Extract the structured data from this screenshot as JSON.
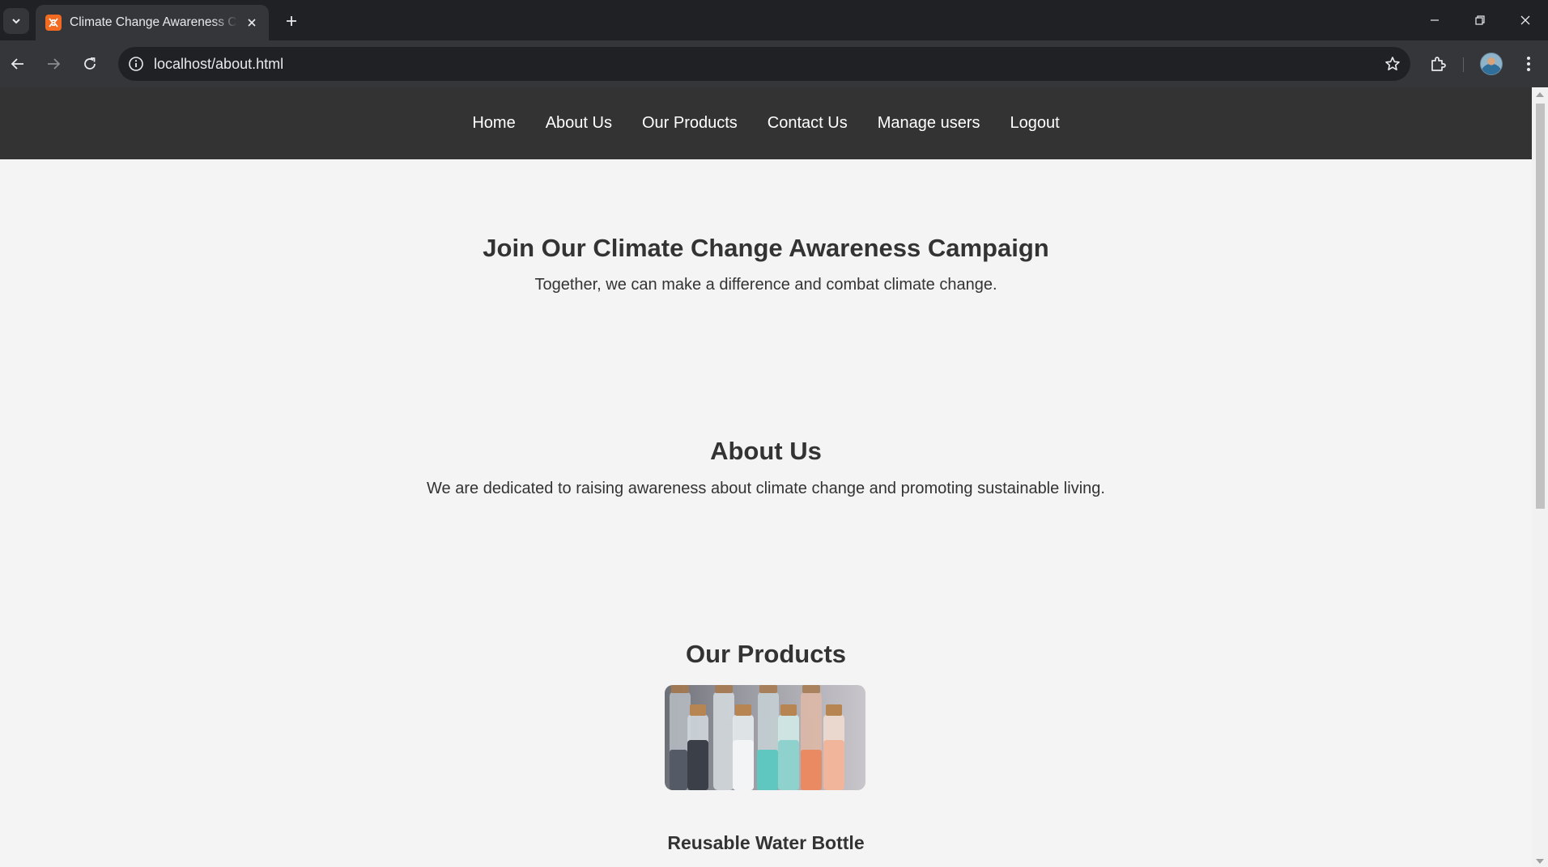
{
  "browser": {
    "tab_title": "Climate Change Awareness Campaign",
    "url": "localhost/about.html"
  },
  "nav": {
    "items": [
      "Home",
      "About Us",
      "Our Products",
      "Contact Us",
      "Manage users",
      "Logout"
    ]
  },
  "hero": {
    "title": "Join Our Climate Change Awareness Campaign",
    "text": "Together, we can make a difference and combat climate change."
  },
  "about": {
    "title": "About Us",
    "text": "We are dedicated to raising awareness about climate change and promoting sustainable living."
  },
  "products": {
    "title": "Our Products",
    "items": [
      {
        "name": "Reusable Water Bottle",
        "image": "reusable-water-bottles-photo"
      }
    ]
  },
  "colors": {
    "nav_bg": "#333333",
    "page_bg": "#f4f4f4",
    "text": "#333333"
  }
}
